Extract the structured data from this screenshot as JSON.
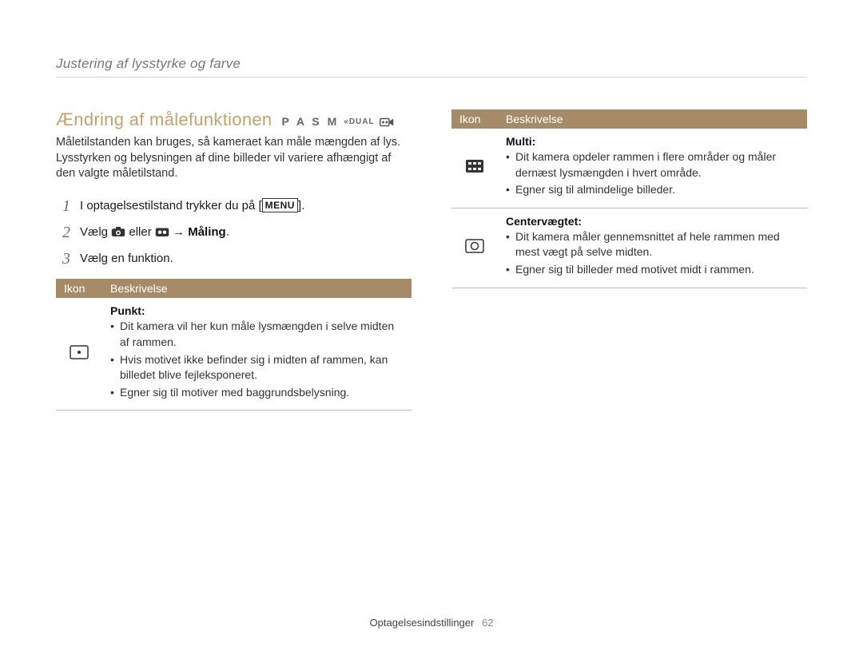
{
  "breadcrumb": "Justering af lysstyrke og farve",
  "heading": "Ændring af målefunktionen",
  "mode_letters": "P A S M",
  "mode_dual": "DUAL",
  "intro": "Måletilstanden kan bruges, så kameraet kan måle mængden af lys. Lysstyrken og belysningen af dine billeder vil variere afhængigt af den valgte måletilstand.",
  "steps": [
    {
      "num": "1",
      "pre": "I optagelsestilstand trykker du på [",
      "menu": "MENU",
      "post": "]."
    },
    {
      "num": "2",
      "pre": "Vælg ",
      "eller": " eller ",
      "arrow": " → ",
      "bold": "Måling",
      "post": "."
    },
    {
      "num": "3",
      "text": "Vælg en funktion."
    }
  ],
  "table_headers": {
    "icon": "Ikon",
    "desc": "Beskrivelse"
  },
  "left_rows": [
    {
      "icon": "spot",
      "title": "Punkt",
      "bullets": [
        "Dit kamera vil her kun måle lysmængden i selve midten af rammen.",
        "Hvis motivet ikke befinder sig i midten af rammen, kan billedet blive fejleksponeret.",
        "Egner sig til motiver med baggrundsbelysning."
      ]
    }
  ],
  "right_rows": [
    {
      "icon": "multi",
      "title": "Multi",
      "bullets": [
        "Dit kamera opdeler rammen i flere områder og måler dernæst lysmængden i hvert område.",
        "Egner sig til almindelige billeder."
      ]
    },
    {
      "icon": "center",
      "title": "Centervægtet",
      "bullets": [
        "Dit kamera måler gennemsnittet af hele rammen med mest vægt på selve midten.",
        "Egner sig til billeder med motivet midt i rammen."
      ]
    }
  ],
  "footer": {
    "section": "Optagelsesindstillinger",
    "page": "62"
  }
}
